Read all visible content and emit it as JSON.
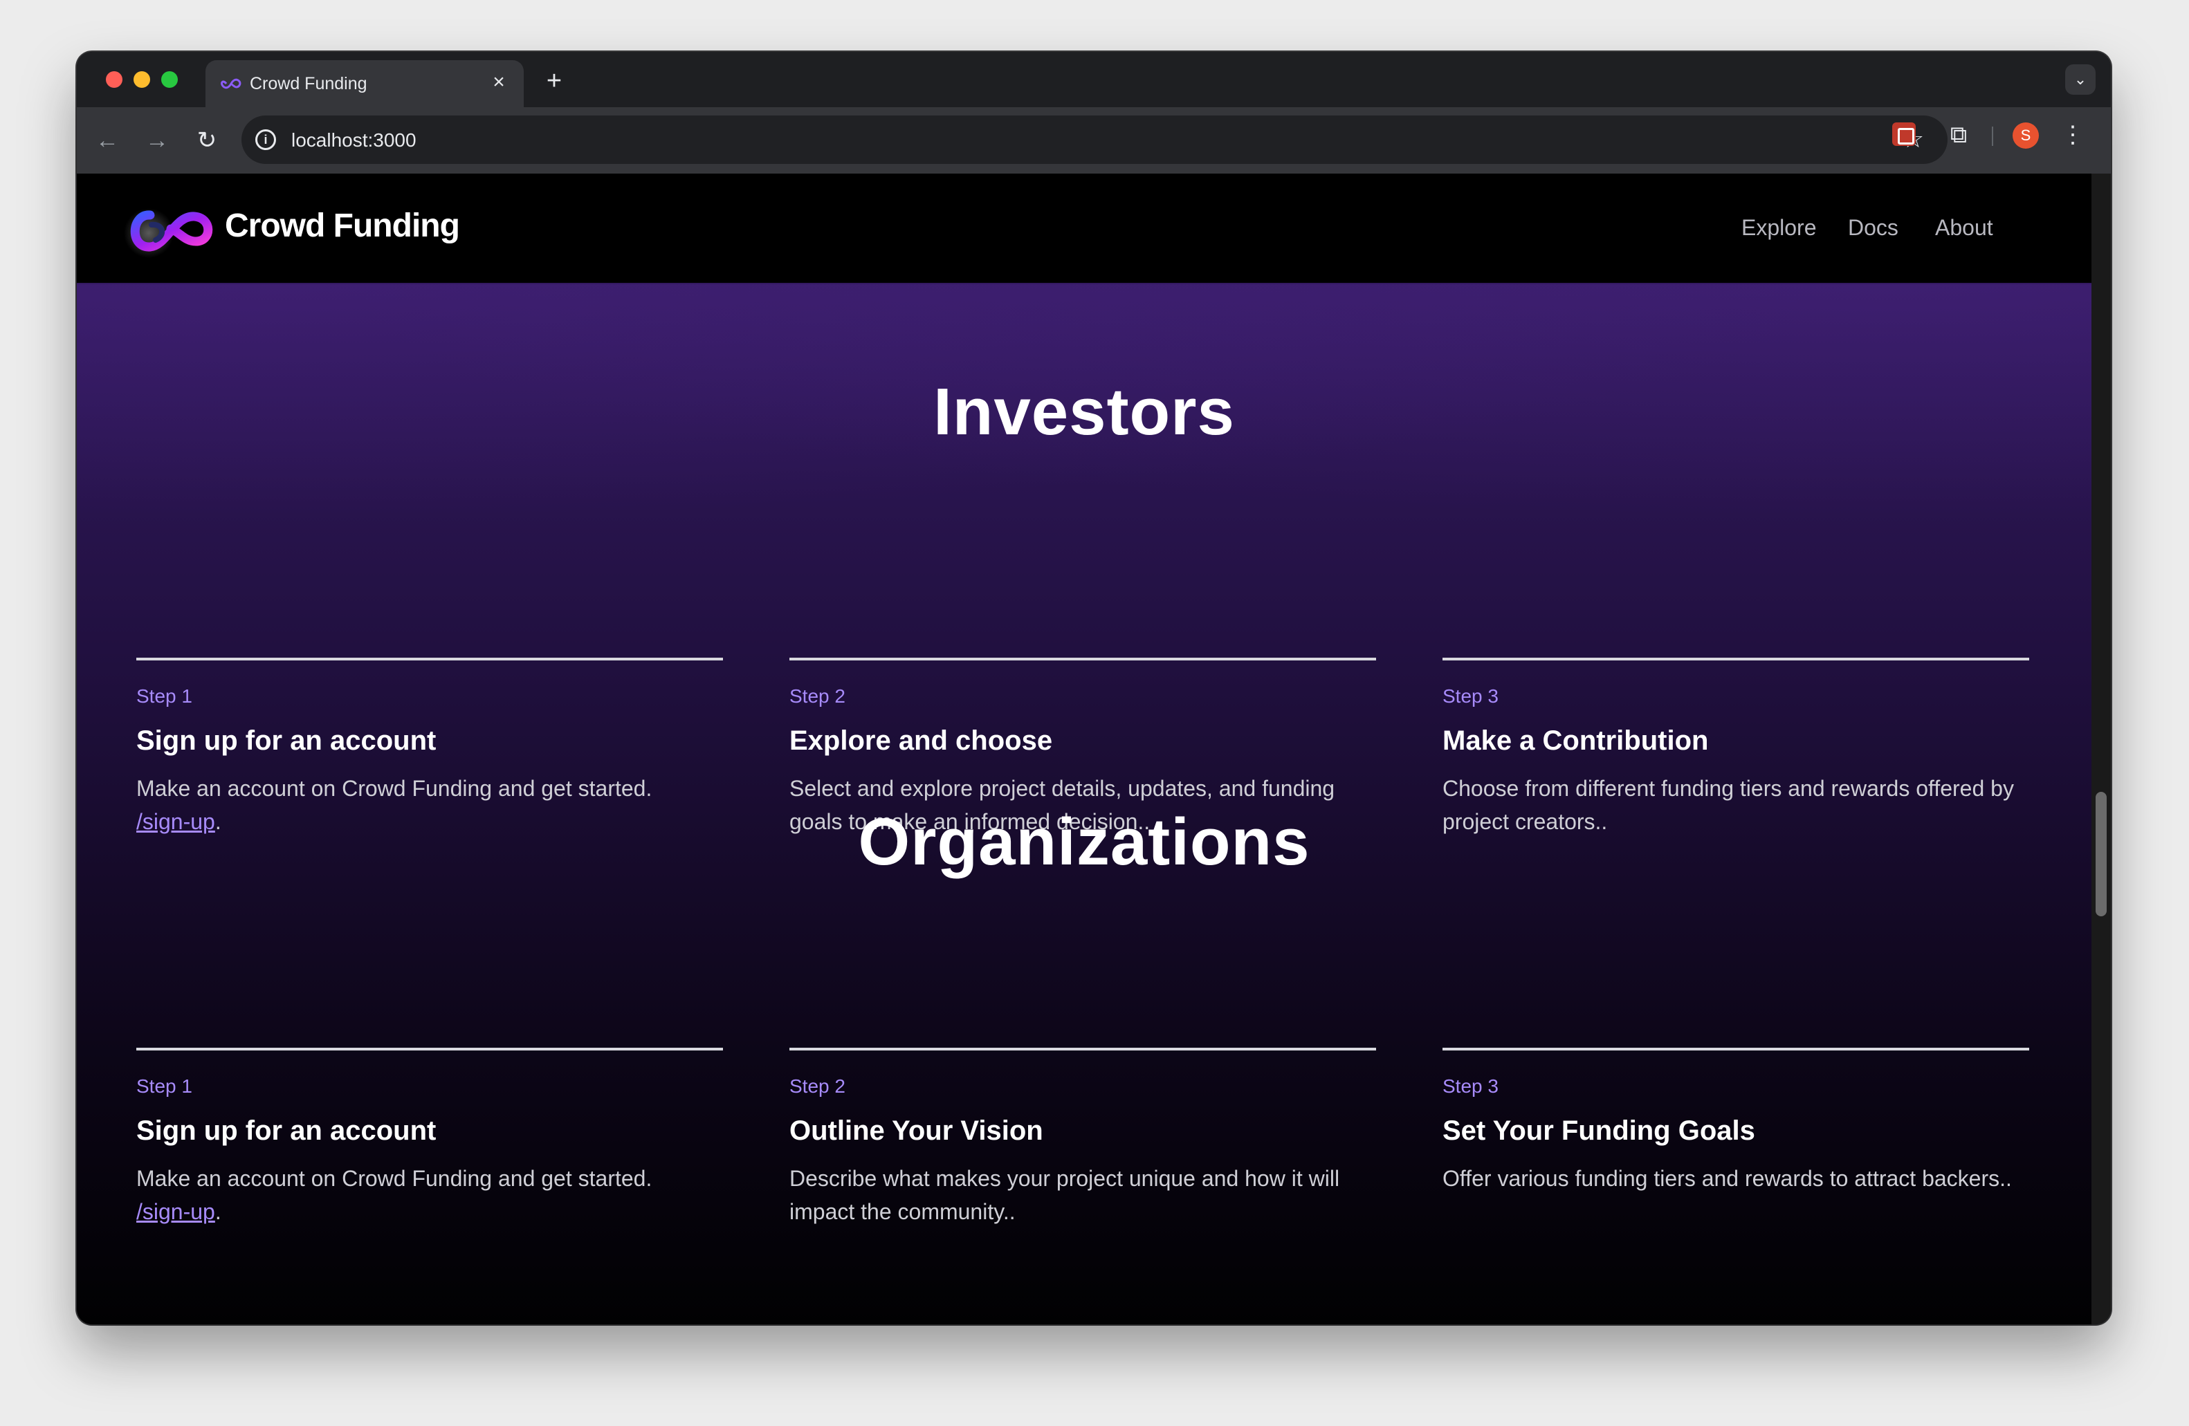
{
  "browser": {
    "tab_title": "Crowd Funding",
    "tab_close": "×",
    "new_tab": "+",
    "url": "localhost:3000",
    "profile_initial": "S"
  },
  "site": {
    "brand": "Crowd Funding",
    "nav": {
      "explore": "Explore",
      "docs": "Docs",
      "about": "About"
    }
  },
  "investors": {
    "title": "Investors",
    "steps": [
      {
        "label": "Step 1",
        "heading": "Sign up for an account",
        "desc": "Make an account on Crowd Funding and get started.",
        "link": "/sign-up",
        "link_suffix": "."
      },
      {
        "label": "Step 2",
        "heading": "Explore and choose",
        "desc": "Select and explore project details, updates, and funding goals to make an informed decision.."
      },
      {
        "label": "Step 3",
        "heading": "Make a Contribution",
        "desc": "Choose from different funding tiers and rewards offered by project creators.."
      }
    ]
  },
  "organizations": {
    "title": "Organizations",
    "steps": [
      {
        "label": "Step 1",
        "heading": "Sign up for an account",
        "desc": "Make an account on Crowd Funding and get started.",
        "link": "/sign-up",
        "link_suffix": "."
      },
      {
        "label": "Step 2",
        "heading": "Outline Your Vision",
        "desc": "Describe what makes your project unique and how it will impact the community.."
      },
      {
        "label": "Step 3",
        "heading": "Set Your Funding Goals",
        "desc": "Offer various funding tiers and rewards to attract backers.."
      }
    ]
  },
  "colors": {
    "accent": "#a78bfa",
    "header_bg": "#000000",
    "gradient_top": "#3b1e6e"
  },
  "icons": [
    "back-arrow-icon",
    "forward-arrow-icon",
    "reload-icon",
    "info-icon",
    "star-icon",
    "extension-icon",
    "puzzle-icon",
    "kebab-menu-icon",
    "infinity-logo-icon"
  ]
}
